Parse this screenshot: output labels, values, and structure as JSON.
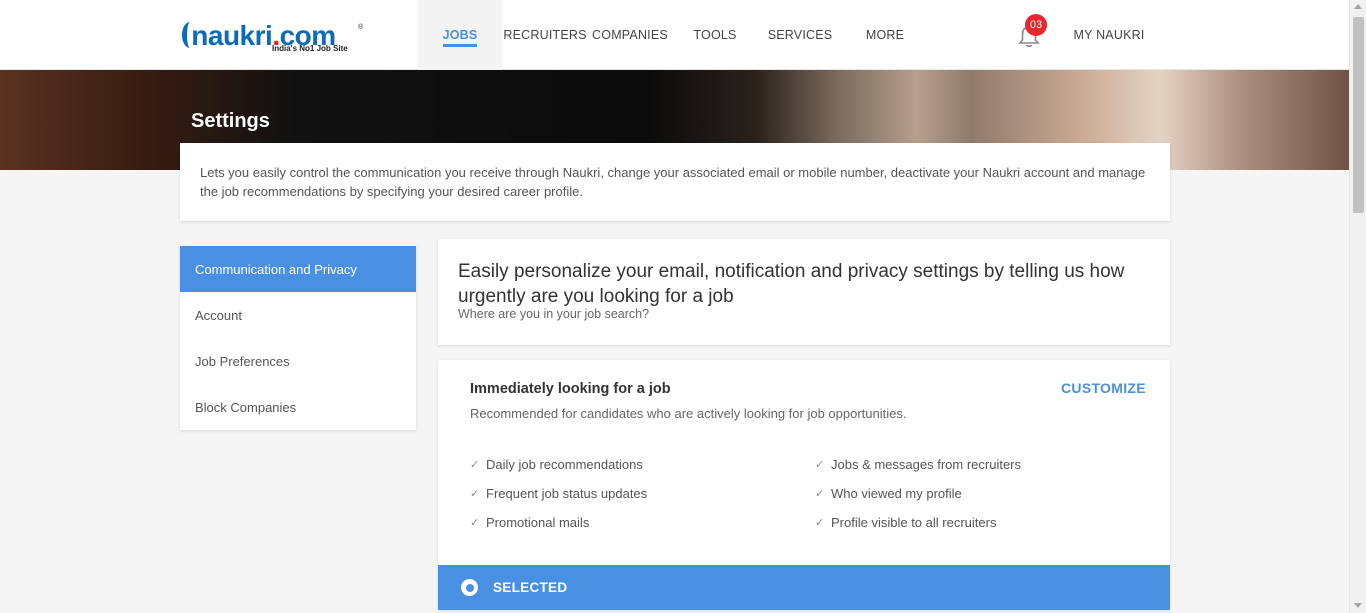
{
  "logo": {
    "name": "naukri.com",
    "name_main": "naukri",
    "name_dot": ".",
    "name_tld": "com",
    "reg": "®",
    "tagline": "India's No1 Job Site"
  },
  "nav": {
    "jobs": "JOBS",
    "recruiters": "RECRUITERS",
    "companies": "COMPANIES",
    "tools": "TOOLS",
    "services": "SERVICES",
    "more": "MORE",
    "notifications_count": "03",
    "my_naukri": "MY NAUKRI"
  },
  "banner": {
    "title": "Settings"
  },
  "description": "Lets you easily control the communication you receive through Naukri, change your associated email or mobile number, deactivate your Naukri account and manage the job recommendations by specifying your desired career profile.",
  "sidebar": {
    "items": [
      {
        "label": "Communication and Privacy",
        "active": true
      },
      {
        "label": "Account",
        "active": false
      },
      {
        "label": "Job Preferences",
        "active": false
      },
      {
        "label": "Block Companies",
        "active": false
      }
    ]
  },
  "main": {
    "heading": "Easily personalize your email, notification and privacy settings by telling us how urgently are you looking for a job",
    "subheading": "Where are you in your job search?",
    "option": {
      "title": "Immediately looking for a job",
      "description": "Recommended for candidates who are actively looking for job opportunities.",
      "customize_label": "CUSTOMIZE",
      "features_left": [
        "Daily job recommendations",
        "Frequent job status updates",
        "Promotional mails"
      ],
      "features_right": [
        "Jobs & messages from recruiters",
        "Who viewed my profile",
        "Profile visible to all recruiters"
      ],
      "selected_label": "SELECTED"
    }
  },
  "colors": {
    "accent": "#4a90e2",
    "badge": "#e8262b",
    "brand": "#0d6cb8"
  },
  "icons": {
    "bell": "bell-icon",
    "check": "check-icon",
    "radio": "radio-selected-icon"
  }
}
